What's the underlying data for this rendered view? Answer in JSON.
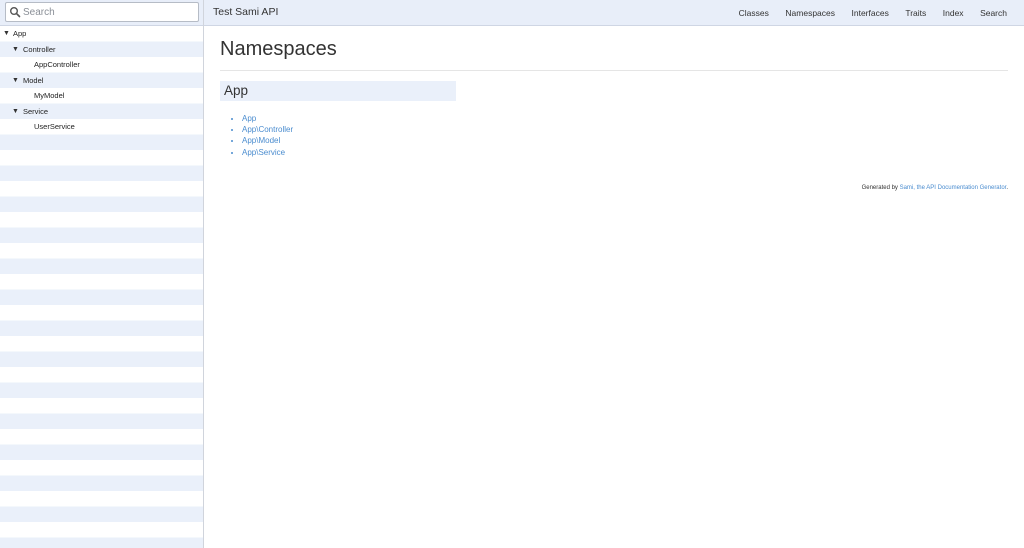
{
  "search": {
    "placeholder": "Search",
    "value": ""
  },
  "tree": [
    {
      "label": "App",
      "expanded": true,
      "depth": 0
    },
    {
      "label": "Controller",
      "expanded": true,
      "depth": 1
    },
    {
      "label": "AppController",
      "depth": 2
    },
    {
      "label": "Model",
      "expanded": true,
      "depth": 1
    },
    {
      "label": "MyModel",
      "depth": 2
    },
    {
      "label": "Service",
      "expanded": true,
      "depth": 1
    },
    {
      "label": "UserService",
      "depth": 2
    }
  ],
  "header": {
    "title": "Test Sami API",
    "nav": [
      "Classes",
      "Namespaces",
      "Interfaces",
      "Traits",
      "Index",
      "Search"
    ]
  },
  "main": {
    "title": "Namespaces",
    "section_heading": "App",
    "namespaces": [
      "App",
      "App\\Controller",
      "App\\Model",
      "App\\Service"
    ]
  },
  "footer": {
    "prefix": "Generated by ",
    "link": "Sami, the API Documentation Generator",
    "suffix": "."
  },
  "colors": {
    "accent_link": "#4a8ccf",
    "header_bg": "#e8eef9",
    "row_alt": "#eaf0fa"
  },
  "icons": {
    "search": "magnifier-icon",
    "expanded": "triangle-down-icon"
  }
}
